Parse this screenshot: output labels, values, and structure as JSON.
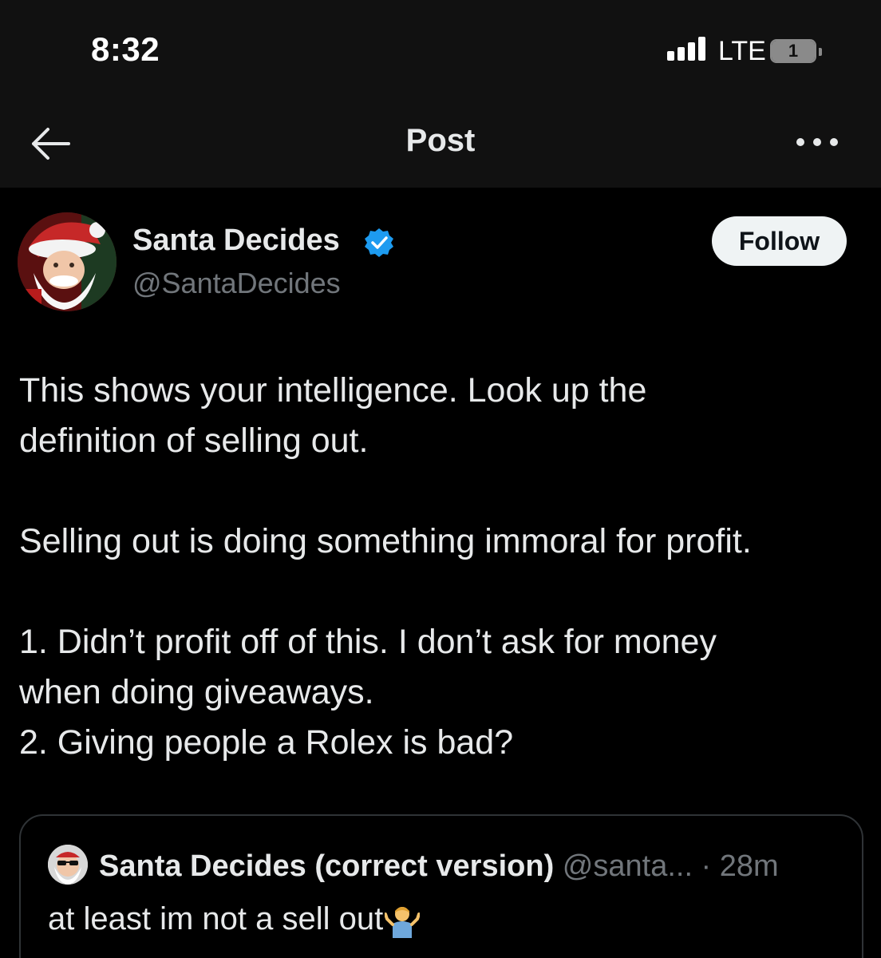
{
  "status_bar": {
    "time": "8:32",
    "network": "LTE",
    "battery": "1",
    "battery_level": 0.01,
    "signal_bars": 4
  },
  "header": {
    "title": "Post",
    "back_icon": "arrow-left-icon",
    "more_icon": "more-horizontal-icon"
  },
  "post": {
    "author_name": "Santa Decides",
    "author_handle": "@SantaDecides",
    "verified_icon": "verified-badge-icon",
    "follow_label": "Follow",
    "body_lines": [
      "This shows your intelligence. Look up the",
      "definition of selling out.",
      "",
      "Selling out is doing something immoral for profit.",
      "",
      "1. Didn’t profit off of this. I don’t ask for money",
      "when doing giveaways.",
      "2. Giving people a Rolex is bad?"
    ]
  },
  "quote": {
    "author_name": "Santa Decides (correct version)",
    "handle_time": "@santa... · 28m",
    "text": "at least im not a sell out",
    "emoji_icon": "person-shrugging-icon"
  },
  "colors": {
    "background": "#000000",
    "header_background": "#111111",
    "text": "#e7e9ea",
    "secondary_text": "#71767b",
    "verified": "#1d9bf0",
    "follow_button_bg": "#eff3f4",
    "border": "#2f3336"
  }
}
